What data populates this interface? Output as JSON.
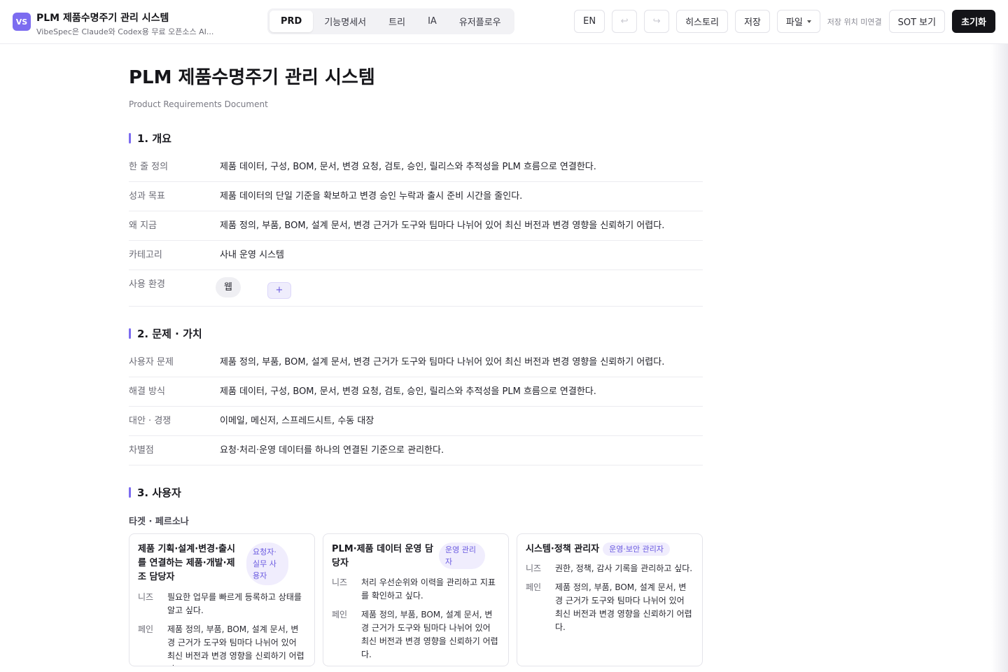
{
  "header": {
    "logo_text": "VS",
    "title": "PLM 제품수명주기 관리 시스템",
    "subtitle": "VibeSpec은 Claude와 Codex용 무료 오픈소스 AI...",
    "tabs": [
      {
        "label": "PRD",
        "active": true
      },
      {
        "label": "기능명세서",
        "active": false
      },
      {
        "label": "트리",
        "active": false
      },
      {
        "label": "IA",
        "active": false
      },
      {
        "label": "유저플로우",
        "active": false
      }
    ],
    "lang_label": "EN",
    "undo_icon": "↩",
    "redo_icon": "↪",
    "history_label": "히스토리",
    "save_label": "저장",
    "file_label": "파일",
    "save_location": "저장 위치 미연결",
    "sot_label": "SOT 보기",
    "reset_label": "초기화"
  },
  "doc": {
    "title": "PLM 제품수명주기 관리 시스템",
    "subtitle": "Product Requirements Document",
    "section1": {
      "heading": "1. 개요",
      "rows": [
        {
          "k": "한 줄 정의",
          "v": "제품 데이터, 구성, BOM, 문서, 변경 요청, 검토, 승인, 릴리스와 추적성을 PLM 흐름으로 연결한다."
        },
        {
          "k": "성과 목표",
          "v": "제품 데이터의 단일 기준을 확보하고 변경 승인 누락과 출시 준비 시간을 줄인다."
        },
        {
          "k": "왜 지금",
          "v": "제품 정의, 부품, BOM, 설계 문서, 변경 근거가 도구와 팀마다 나뉘어 있어 최신 버전과 변경 영향을 신뢰하기 어렵다."
        },
        {
          "k": "카테고리",
          "v": "사내 운영 시스템"
        }
      ],
      "env_label": "사용 환경",
      "env_chip": "웹",
      "env_add": "+"
    },
    "section2": {
      "heading": "2. 문제 · 가치",
      "rows": [
        {
          "k": "사용자 문제",
          "v": "제품 정의, 부품, BOM, 설계 문서, 변경 근거가 도구와 팀마다 나뉘어 있어 최신 버전과 변경 영향을 신뢰하기 어렵다."
        },
        {
          "k": "해결 방식",
          "v": "제품 데이터, 구성, BOM, 문서, 변경 요청, 검토, 승인, 릴리스와 추적성을 PLM 흐름으로 연결한다."
        },
        {
          "k": "대안 · 경쟁",
          "v": "이메일, 메신저, 스프레드시트, 수동 대장"
        },
        {
          "k": "차별점",
          "v": "요청·처리·운영 데이터를 하나의 연결된 기준으로 관리한다."
        }
      ]
    },
    "section3": {
      "heading": "3. 사용자",
      "persona_heading": "타겟 · 페르소나",
      "needs_label": "니즈",
      "pain_label": "페인",
      "personas": [
        {
          "title": "제품 기획·설계·변경·출시를 연결하는 제품·개발·제조 담당자",
          "badge": "요청자·실무 사용자",
          "needs": "필요한 업무를 빠르게 등록하고 상태를 알고 싶다.",
          "pain": "제품 정의, 부품, BOM, 설계 문서, 변경 근거가 도구와 팀마다 나뉘어 있어 최신 버전과 변경 영향을 신뢰하기 어렵다."
        },
        {
          "title": "PLM·제품 데이터 운영 담당자",
          "badge": "운영 관리자",
          "needs": "처리 우선순위와 이력을 관리하고 지표를 확인하고 싶다.",
          "pain": "제품 정의, 부품, BOM, 설계 문서, 변경 근거가 도구와 팀마다 나뉘어 있어 최신 버전과 변경 영향을 신뢰하기 어렵다."
        },
        {
          "title": "시스템·정책 관리자",
          "badge": "운영·보안 관리자",
          "needs": "권한, 정책, 감사 기록을 관리하고 싶다.",
          "pain": "제품 정의, 부품, BOM, 설계 문서, 변경 근거가 도구와 팀마다 나뉘어 있어 최신 버전과 변경 영향을 신뢰하기 어렵다."
        }
      ]
    }
  },
  "colors": {
    "accent": "#7c6cf0",
    "dark_button": "#141418",
    "badge_bg": "#f0edfd"
  }
}
